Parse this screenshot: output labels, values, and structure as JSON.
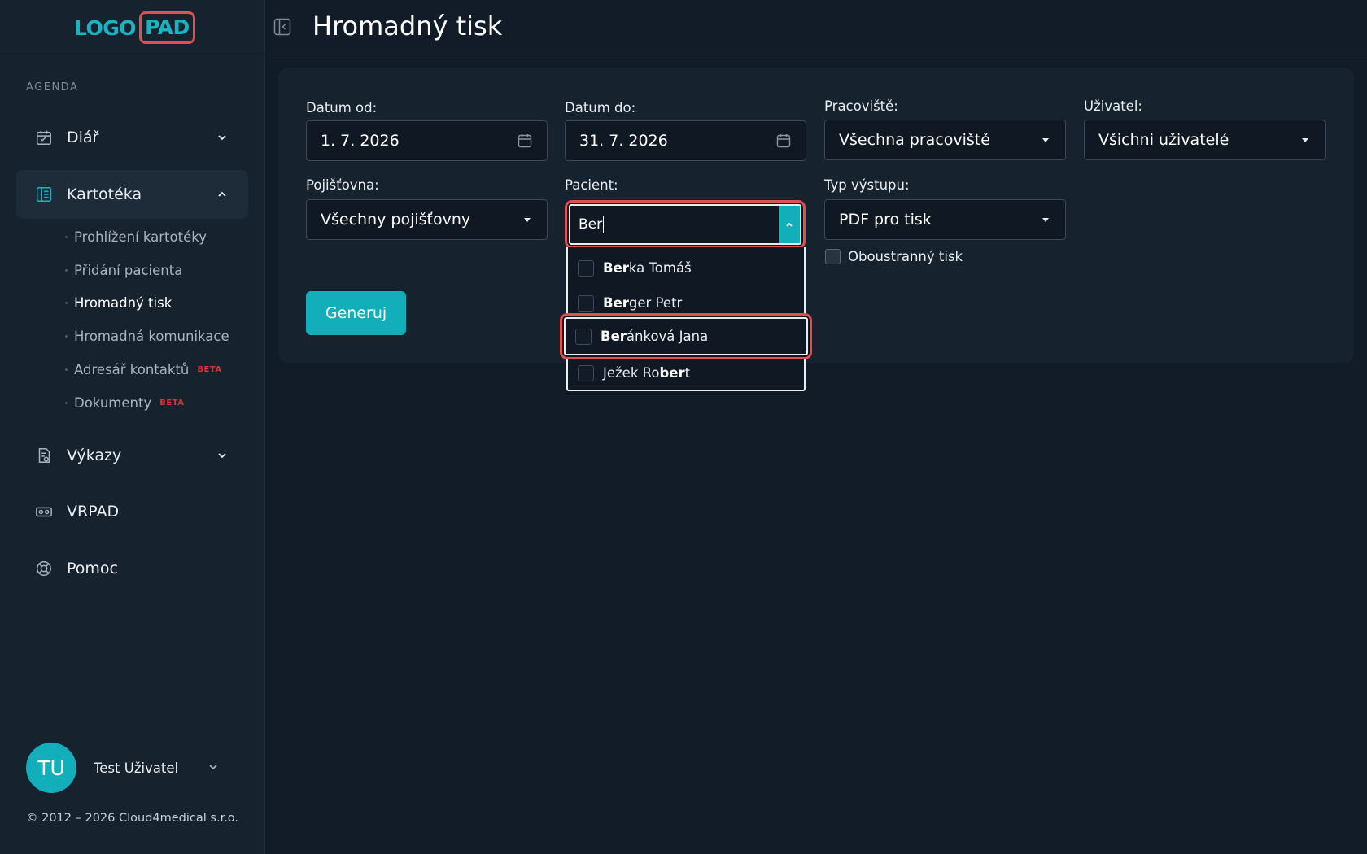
{
  "logo": {
    "part1": "LOGO",
    "part2": "PAD"
  },
  "sidebar": {
    "section": "AGENDA",
    "items": [
      {
        "label": "Diář"
      },
      {
        "label": "Kartotéka"
      },
      {
        "label": "Výkazy"
      },
      {
        "label": "VRPAD"
      },
      {
        "label": "Pomoc"
      }
    ],
    "subitems": [
      {
        "label": "Prohlížení kartotéky"
      },
      {
        "label": "Přidání pacienta"
      },
      {
        "label": "Hromadný tisk"
      },
      {
        "label": "Hromadná komunikace"
      },
      {
        "label": "Adresář kontaktů",
        "badge": "BETA"
      },
      {
        "label": "Dokumenty",
        "badge": "BETA"
      }
    ]
  },
  "user": {
    "initials": "TU",
    "name": "Test Uživatel"
  },
  "copyright": "© 2012 – 2026 Cloud4medical s.r.o.",
  "header": {
    "title": "Hromadný tisk"
  },
  "form": {
    "date_from": {
      "label": "Datum od:",
      "value": "1. 7. 2026"
    },
    "date_to": {
      "label": "Datum do:",
      "value": "31. 7. 2026"
    },
    "workplace": {
      "label": "Pracoviště:",
      "value": "Všechna pracoviště"
    },
    "user": {
      "label": "Uživatel:",
      "value": "Všichni uživatelé"
    },
    "insurance": {
      "label": "Pojišťovna:",
      "value": "Všechny pojišťovny"
    },
    "patient": {
      "label": "Pacient:",
      "query": "Ber",
      "options": [
        {
          "match": "Ber",
          "rest": "ka Tomáš"
        },
        {
          "match": "Ber",
          "rest": "ger Petr"
        },
        {
          "match": "Ber",
          "rest": "ánková Jana"
        },
        {
          "pre": "Ježek Ro",
          "match": "ber",
          "rest": "t"
        }
      ]
    },
    "output_type": {
      "label": "Typ výstupu:",
      "value": "PDF pro tisk"
    },
    "duplex": {
      "label": "Oboustranný tisk",
      "checked": false
    },
    "generate_label": "Generuj"
  },
  "colors": {
    "accent": "#12aeb9",
    "highlight": "#e0504f",
    "beta": "#e0302f"
  }
}
